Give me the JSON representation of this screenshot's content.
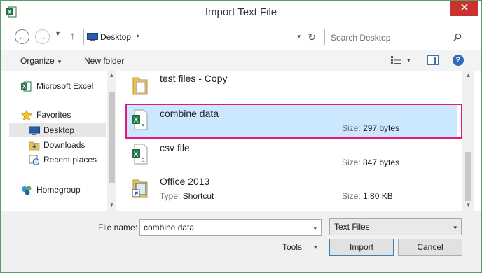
{
  "window": {
    "title": "Import Text File",
    "close_glyph": "✕"
  },
  "nav": {
    "back_glyph": "←",
    "forward_glyph": "→",
    "recent_glyph": "▾",
    "up_glyph": "↑",
    "address": "Desktop",
    "address_chevron": "▸",
    "address_dropdown": "▾",
    "refresh_glyph": "↻",
    "search_placeholder": "Search Desktop"
  },
  "toolbar": {
    "organize": "Organize",
    "new_folder": "New folder",
    "caret": "▾",
    "help_glyph": "?"
  },
  "sidebar": {
    "items": [
      {
        "label": "Microsoft Excel",
        "icon": "excel-icon"
      },
      {
        "label": "Favorites",
        "icon": "star-icon"
      },
      {
        "label": "Desktop",
        "icon": "desktop-icon",
        "selected": true
      },
      {
        "label": "Downloads",
        "icon": "downloads-icon"
      },
      {
        "label": "Recent places",
        "icon": "recent-places-icon"
      },
      {
        "label": "Homegroup",
        "icon": "homegroup-icon"
      }
    ]
  },
  "files": [
    {
      "name": "test files - Copy",
      "icon": "folder-icon",
      "type": "",
      "size": ""
    },
    {
      "name": "combine data",
      "icon": "excel-csv-icon",
      "type": "",
      "size": "297 bytes",
      "selected": true
    },
    {
      "name": "csv file",
      "icon": "excel-csv-icon",
      "type": "",
      "size": "847 bytes"
    },
    {
      "name": "Office 2013",
      "icon": "shortcut-icon",
      "type": "Shortcut",
      "size": "1.80 KB"
    }
  ],
  "labels": {
    "type_key": "Type:",
    "size_key": "Size:"
  },
  "bottom": {
    "file_name_label": "File name:",
    "file_name_value": "combine data",
    "file_type": "Text Files",
    "tools": "Tools",
    "import_button": "Import",
    "cancel_button": "Cancel",
    "dropdown_glyph": "▾"
  },
  "colors": {
    "selection": "#cce8ff",
    "highlight_box": "#e0197a",
    "close": "#c7332e"
  }
}
